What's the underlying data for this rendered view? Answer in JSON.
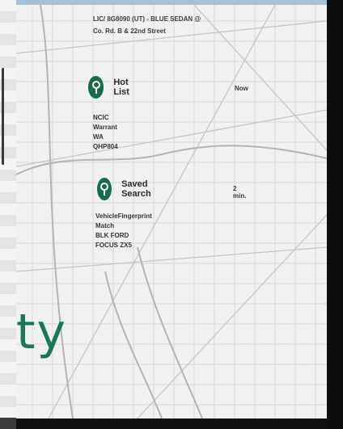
{
  "notification": {
    "plate_line_1": "LIC/ 8G8090 (UT) - BLUE SEDAN @",
    "plate_line_2": "Co. Rd. B & 22nd Street"
  },
  "alerts": [
    {
      "icon": "map-pin-icon",
      "title": "Hot List",
      "time": "Now",
      "detail_1": "NCIC Warrant",
      "detail_2": "WA QHP804"
    },
    {
      "icon": "map-pin-icon",
      "title": "Saved Search",
      "time": "2 min.",
      "detail_1": "VehicleFingerprint Match",
      "detail_2": "BLK FORD FOCUS ZX5"
    }
  ],
  "brand": {
    "fragment": "ty",
    "color": "#157a52"
  },
  "colors": {
    "pin": "#156b4a",
    "map_background": "#f1f1f1"
  }
}
